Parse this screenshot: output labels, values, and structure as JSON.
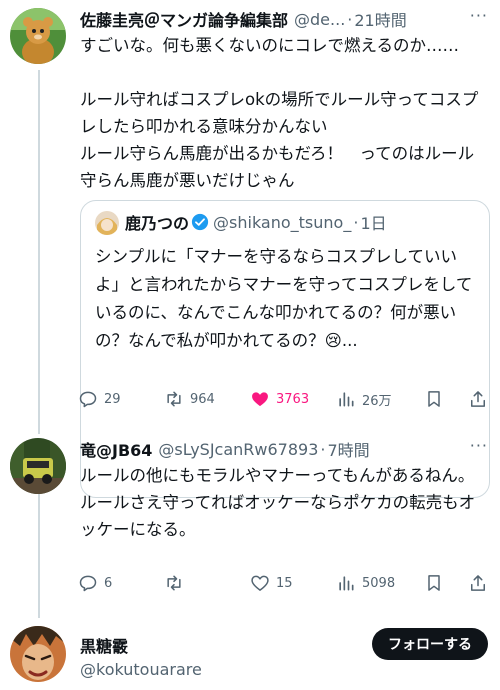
{
  "posts": [
    {
      "name": "佐藤圭亮＠マンガ論争編集部",
      "handle": "@de...",
      "dot": "·",
      "time": "21時間",
      "more": "···",
      "text": "すごいな。何も悪くないのにコレで燃えるのか……\n\nルール守ればコスプレokの場所でルール守ってコスプレしたら叩かれる意味分かんない\nルール守らん馬鹿が出るかもだろ！　ってのはルール守らん馬鹿が悪いだけじゃん",
      "quote": {
        "name": "鹿乃つの",
        "handle": "@shikano_tsuno_",
        "dot": "·",
        "time": "1日",
        "text": "シンプルに「マナーを守るならコスプレしていいよ」と言われたからマナーを守ってコスプレをしているのに、なんでこんな叩かれてるの？何が悪いの？なんで私が叩かれてるの？😢..."
      },
      "actions": {
        "replies": "29",
        "reposts": "964",
        "likes": "3763",
        "views": "26万"
      }
    },
    {
      "name": "竜@JB64",
      "handle": "@sLySJcanRw67893",
      "dot": "·",
      "time": "7時間",
      "more": "···",
      "text": "ルールの他にもモラルやマナーってもんがあるねん。\nルールさえ守ってればオッケーならポケカの転売もオッケーになる。",
      "actions": {
        "replies": "6",
        "reposts": "",
        "likes": "15",
        "views": "5098"
      }
    }
  ],
  "suggested_user": {
    "name": "黒糖霰",
    "handle": "@kokutouarare",
    "follow_label": "フォローする"
  },
  "colors": {
    "text": "#0f1419",
    "secondary": "#536471",
    "like": "#f91880",
    "verified": "#1d9bf0",
    "border": "#cfd9de"
  }
}
